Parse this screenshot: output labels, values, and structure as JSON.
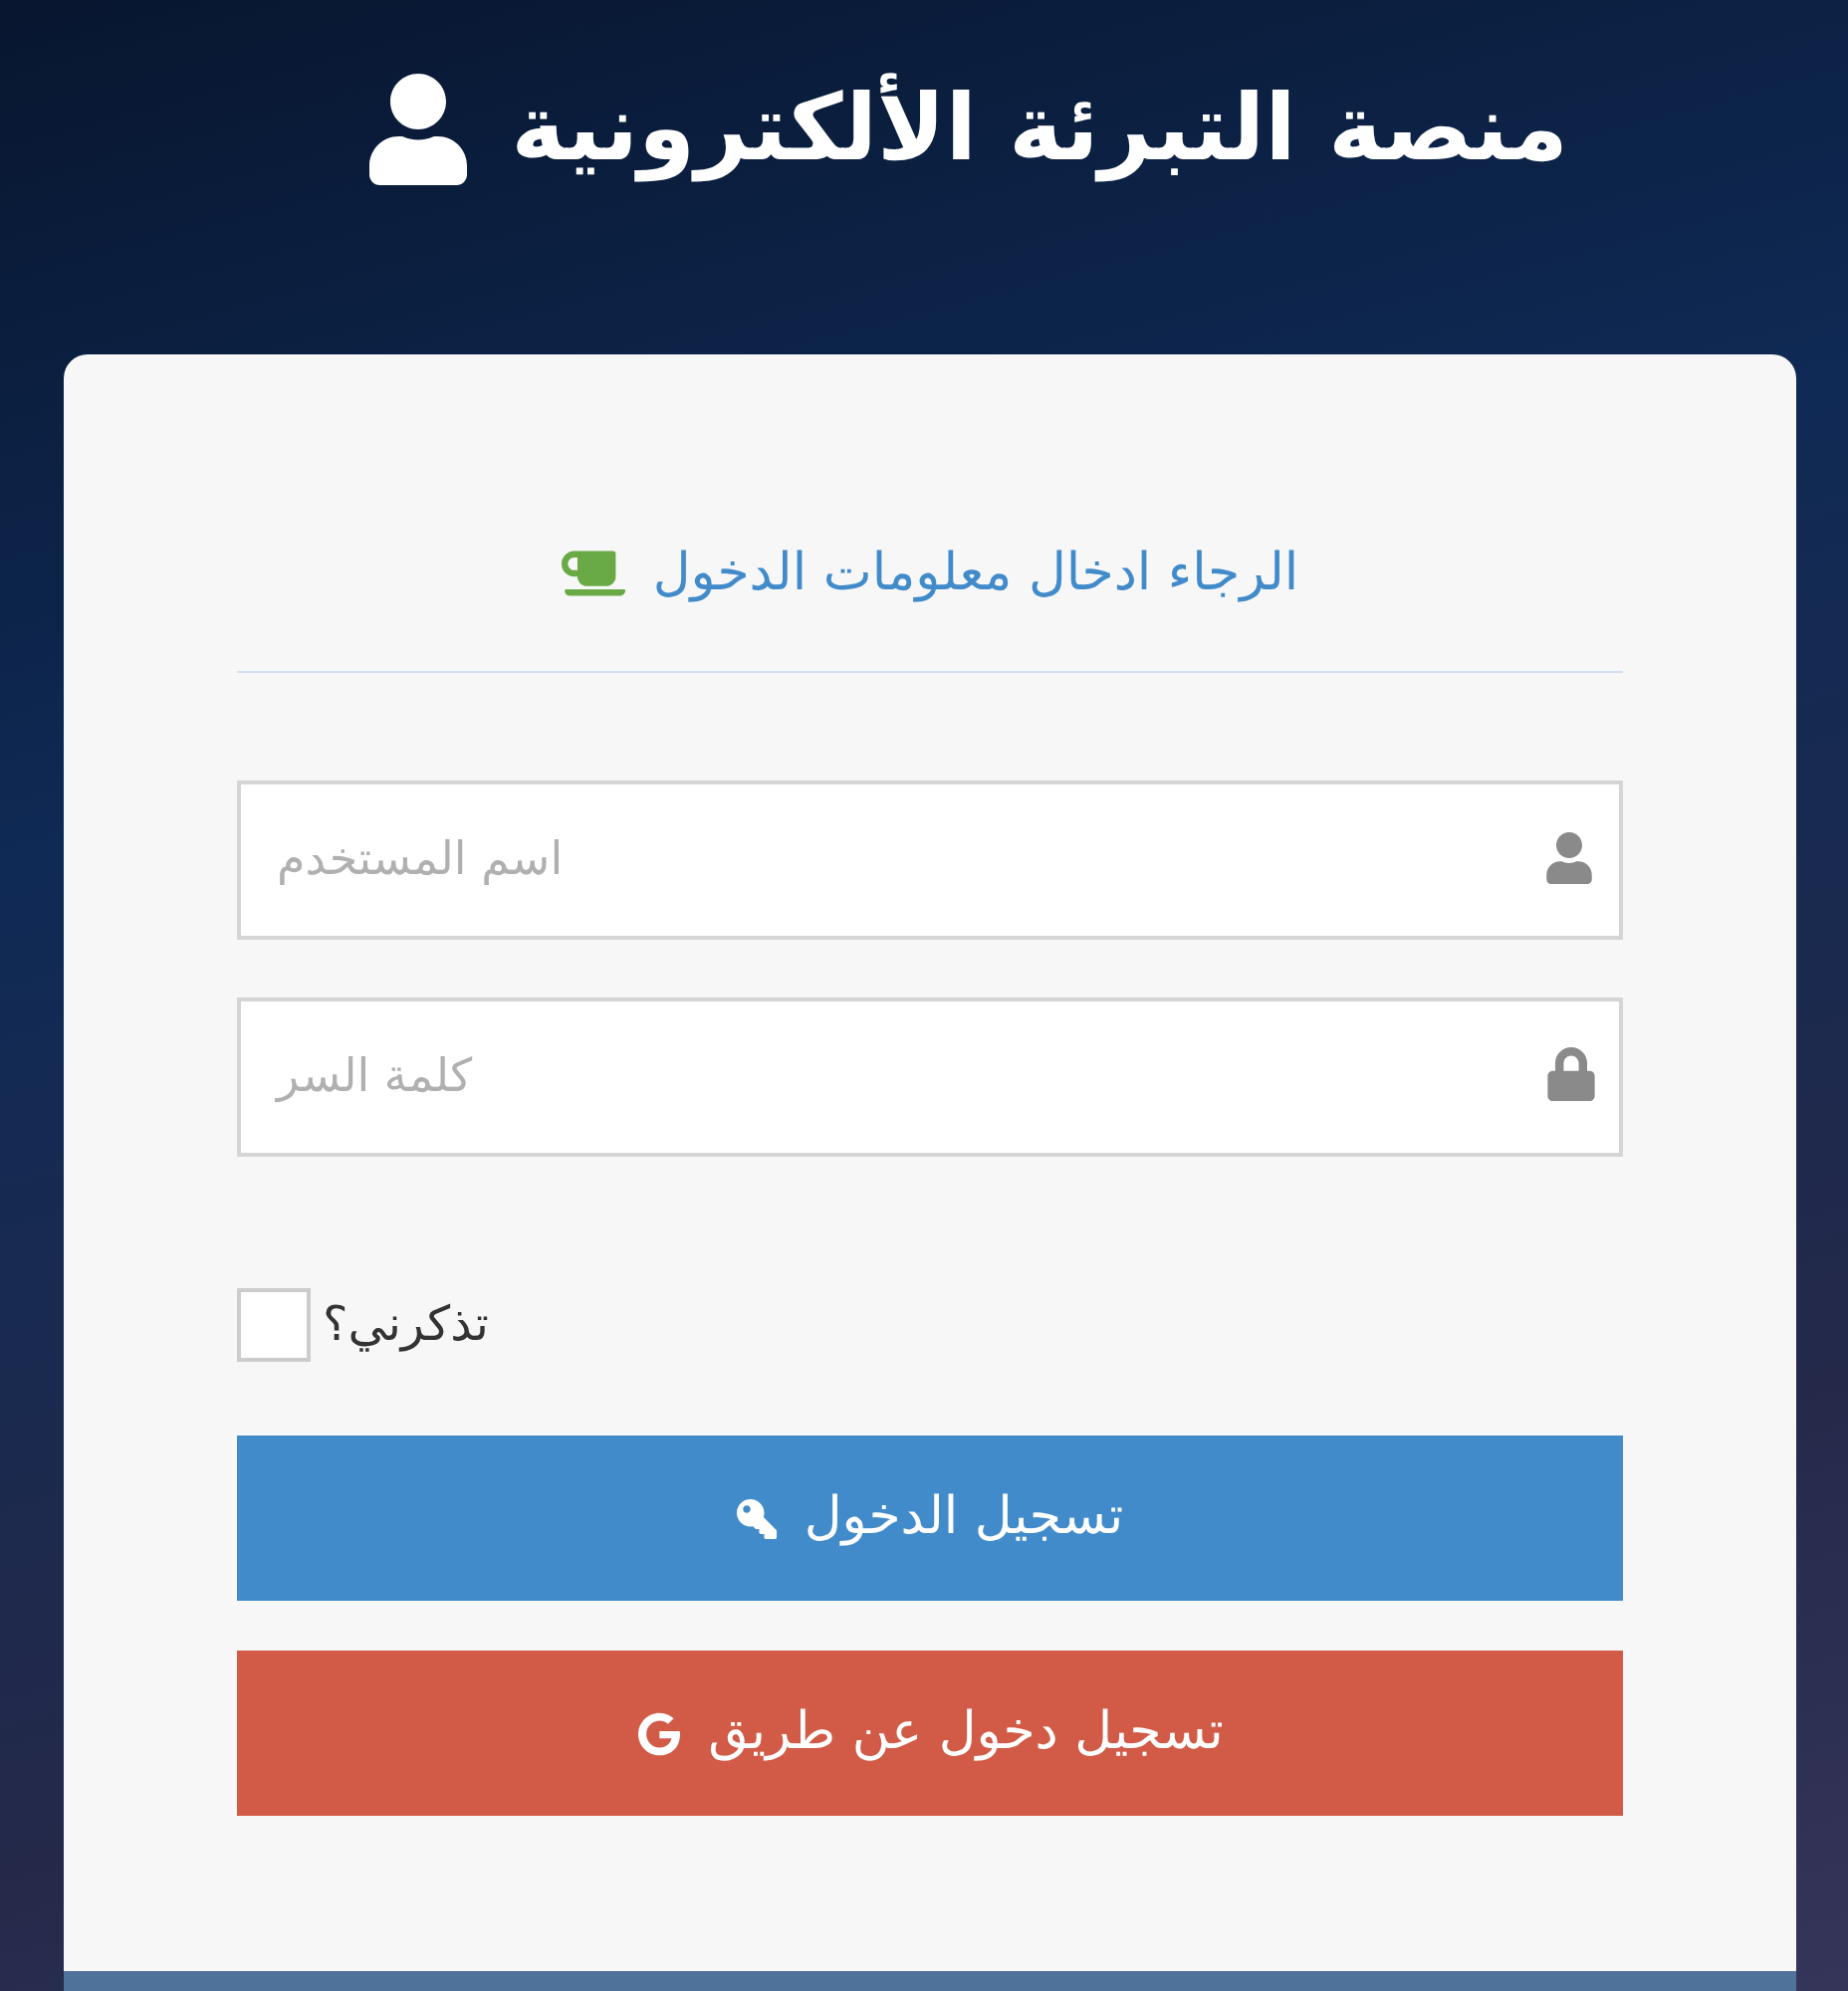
{
  "header": {
    "title": "منصة التبرئة الألكترونية"
  },
  "login": {
    "heading": "الرجاء ادخال معلومات الدخول",
    "fields": [
      {
        "kind": "username",
        "placeholder": "اسم المستخدم"
      },
      {
        "kind": "password",
        "placeholder": "كلمة السر"
      }
    ],
    "remember": {
      "label": "تذكرني؟",
      "checked": false
    },
    "buttons": [
      {
        "kind": "primary",
        "label": "تسجيل الدخول"
      },
      {
        "kind": "google",
        "label": "تسجيل دخول عن طريق"
      }
    ]
  }
}
